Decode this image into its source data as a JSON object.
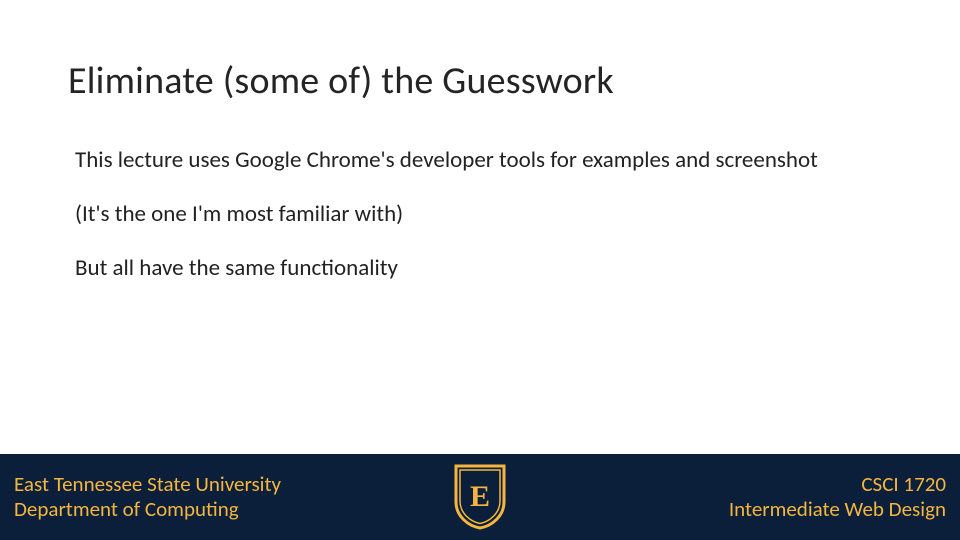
{
  "slide": {
    "title": "Eliminate (some of) the Guesswork",
    "paragraphs": [
      "This lecture uses Google Chrome's developer tools for examples and screenshot",
      "(It's the one I'm most familiar with)",
      "But all have the same functionality"
    ]
  },
  "footer": {
    "left_line1": "East Tennessee State University",
    "left_line2": "Department of Computing",
    "right_line1": "CSCI 1720",
    "right_line2": "Intermediate Web Design",
    "logo_letter": "E"
  },
  "colors": {
    "footer_bg": "#0b1f3a",
    "accent_gold": "#f4b63f"
  }
}
